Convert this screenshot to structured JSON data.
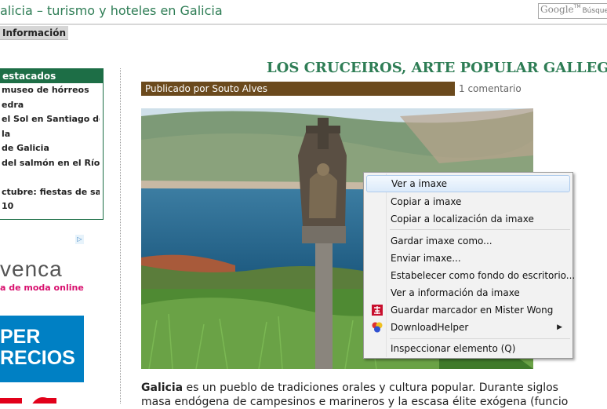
{
  "header": {
    "site_title": "alicia – turismo y hoteles en Galicia",
    "google_label": "Google",
    "google_tm": "TM",
    "search_placeholder": "Búsqueda"
  },
  "nav": {
    "tab_label": "Información"
  },
  "sidebar": {
    "heading": "estacados",
    "items": [
      " museo de hórreos",
      "edra",
      "el Sol en Santiago de",
      "la",
      " de Galicia",
      "del salmón en el Río",
      "",
      "ctubre: fiestas de san",
      "10"
    ]
  },
  "ads": {
    "adchoices_label": "▷",
    "venca_brand": "venca",
    "venca_tagline": "a de moda online",
    "precios_text": "PER\nRECIOS"
  },
  "article": {
    "title": "LOS CRUCEIROS, ARTE POPULAR GALLEGO",
    "byline": "Publicado por Souto Alves",
    "comments": "1 comentario",
    "body_lead": "Galicia",
    "body_line1": " es un pueblo de tradiciones orales y cultura popular. Durante siglos",
    "body_line2": "masa endógena de campesinos e marineros y la escasa élite exógena (funcio"
  },
  "context_menu": {
    "items": [
      {
        "label": "Ver a imaxe",
        "highlighted": true
      },
      {
        "label": "Copiar a imaxe"
      },
      {
        "label": "Copiar a localización da imaxe"
      },
      {
        "label": "Gardar imaxe como..."
      },
      {
        "label": "Enviar imaxe..."
      },
      {
        "label": "Estabelecer como fondo do escritorio..."
      },
      {
        "label": "Ver a información da imaxe"
      },
      {
        "label": "Guardar marcador en Mister Wong",
        "icon": "mister-wong-icon"
      },
      {
        "label": "DownloadHelper",
        "icon": "downloadhelper-icon",
        "submenu": true
      },
      {
        "label": "Inspeccionar elemento (Q)"
      }
    ]
  },
  "colors": {
    "accent_green": "#2e7d55",
    "sidebar_green": "#1d6e46",
    "byline_brown": "#6b4a1d"
  }
}
